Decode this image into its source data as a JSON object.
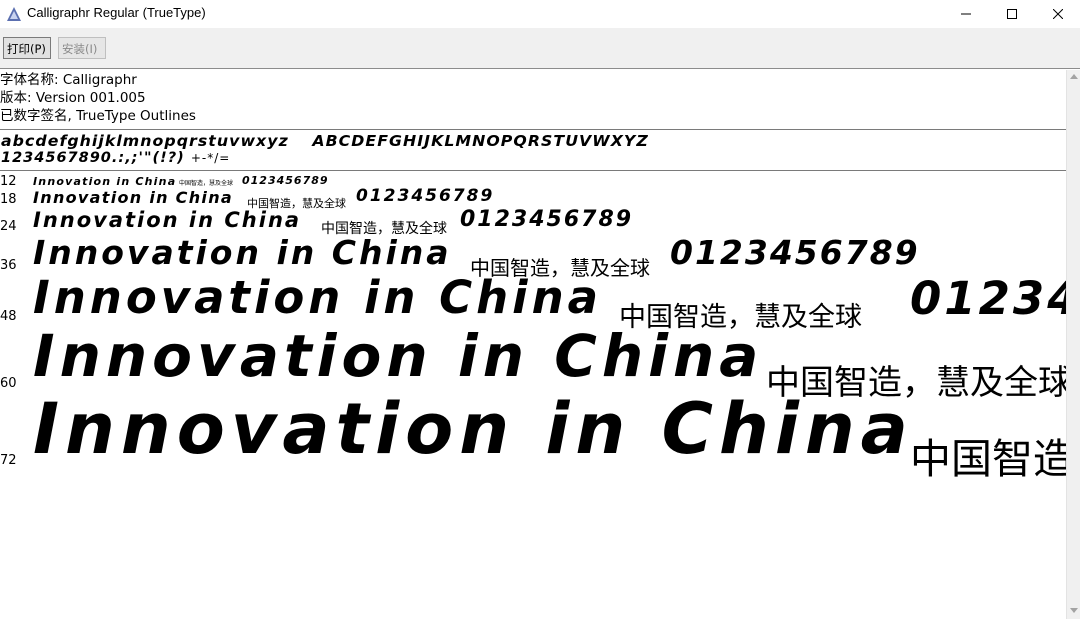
{
  "window": {
    "title": "Calligraphr Regular (TrueType)",
    "min_icon": "minimize-icon",
    "max_icon": "maximize-icon",
    "close_icon": "close-icon"
  },
  "toolbar": {
    "print_label": "打印(P)",
    "install_label": "安装(I)"
  },
  "font_info": {
    "name_line": "字体名称: Calligraphr",
    "version_line": "版本: Version 001.005",
    "signed_line": "已数字签名, TrueType Outlines"
  },
  "charset": {
    "lowercase": "abcdefghijklmnopqrstuvwxyz",
    "uppercase": "ABCDEFGHIJKLMNOPQRSTUVWXYZ",
    "digits_punct": "1234567890.:,;'\"(!?)",
    "symbols": "+-*/="
  },
  "samples": {
    "latin": "Innovation in China",
    "cjk": "中国智造，慧及全球",
    "digits": "0123456789",
    "sizes": [
      {
        "label": "12"
      },
      {
        "label": "18"
      },
      {
        "label": "24"
      },
      {
        "label": "36"
      },
      {
        "label": "48"
      },
      {
        "label": "60"
      },
      {
        "label": "72"
      }
    ]
  }
}
